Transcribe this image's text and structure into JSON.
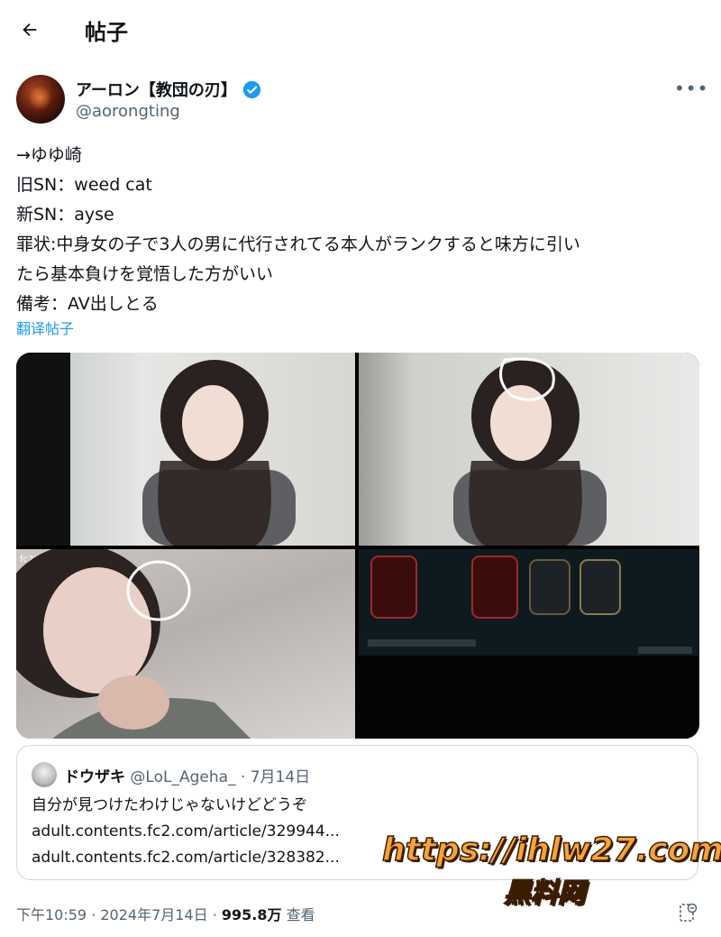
{
  "header": {
    "title": "帖子"
  },
  "author": {
    "name": "アーロン【教団の刃】",
    "handle": "@aorongting",
    "verified": true
  },
  "post": {
    "lines": [
      "→ゆゆ崎",
      "旧SN：weed cat",
      "新SN：ayse",
      "罪状:中身女の子で3人の男に代行されてる本人がランクすると味方に引い",
      "たら基本負けを覚悟した方がいい",
      "備考：AV出しとる"
    ],
    "translate": "翻译帖子"
  },
  "media": {
    "images": [
      {
        "watermark": ""
      },
      {
        "watermark": ""
      },
      {
        "watermark": "fc2tube.com"
      },
      {
        "watermark": ""
      }
    ]
  },
  "quote": {
    "name": "ドウザキ",
    "meta": "@LoL_Ageha_ · 7月14日",
    "lines": [
      "自分が見つけたわけじゃないけどどうぞ",
      "adult.contents.fc2.com/article/329944...",
      "adult.contents.fc2.com/article/328382..."
    ]
  },
  "footer": {
    "time": "下午10:59 · 2024年7月14日 · ",
    "views": "995.8万",
    "views_label": " 查看"
  },
  "watermark": {
    "line1": "https://ihlw27.com",
    "line2": "黑料网"
  },
  "colors": {
    "accent": "#1d9bf0",
    "muted": "#536471",
    "text": "#0f1419"
  }
}
